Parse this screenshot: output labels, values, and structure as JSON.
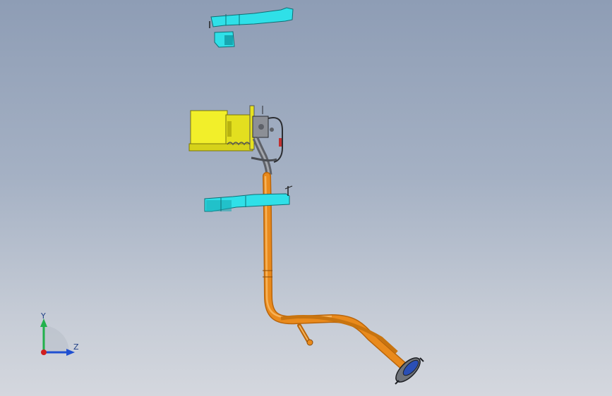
{
  "viewport": {
    "axis_labels": {
      "y": "Y",
      "z": "Z"
    },
    "colors": {
      "pipe": "#e98a1c",
      "pipe_light": "#f6b35a",
      "bracket": "#2fe0e8",
      "bracket_dark": "#16a7b1",
      "tank": "#f2ef2a",
      "tank_dark": "#b8b30f",
      "axis_y": "#22b14c",
      "axis_z": "#1f4fd1",
      "axis_x": "#d01f1f"
    }
  }
}
